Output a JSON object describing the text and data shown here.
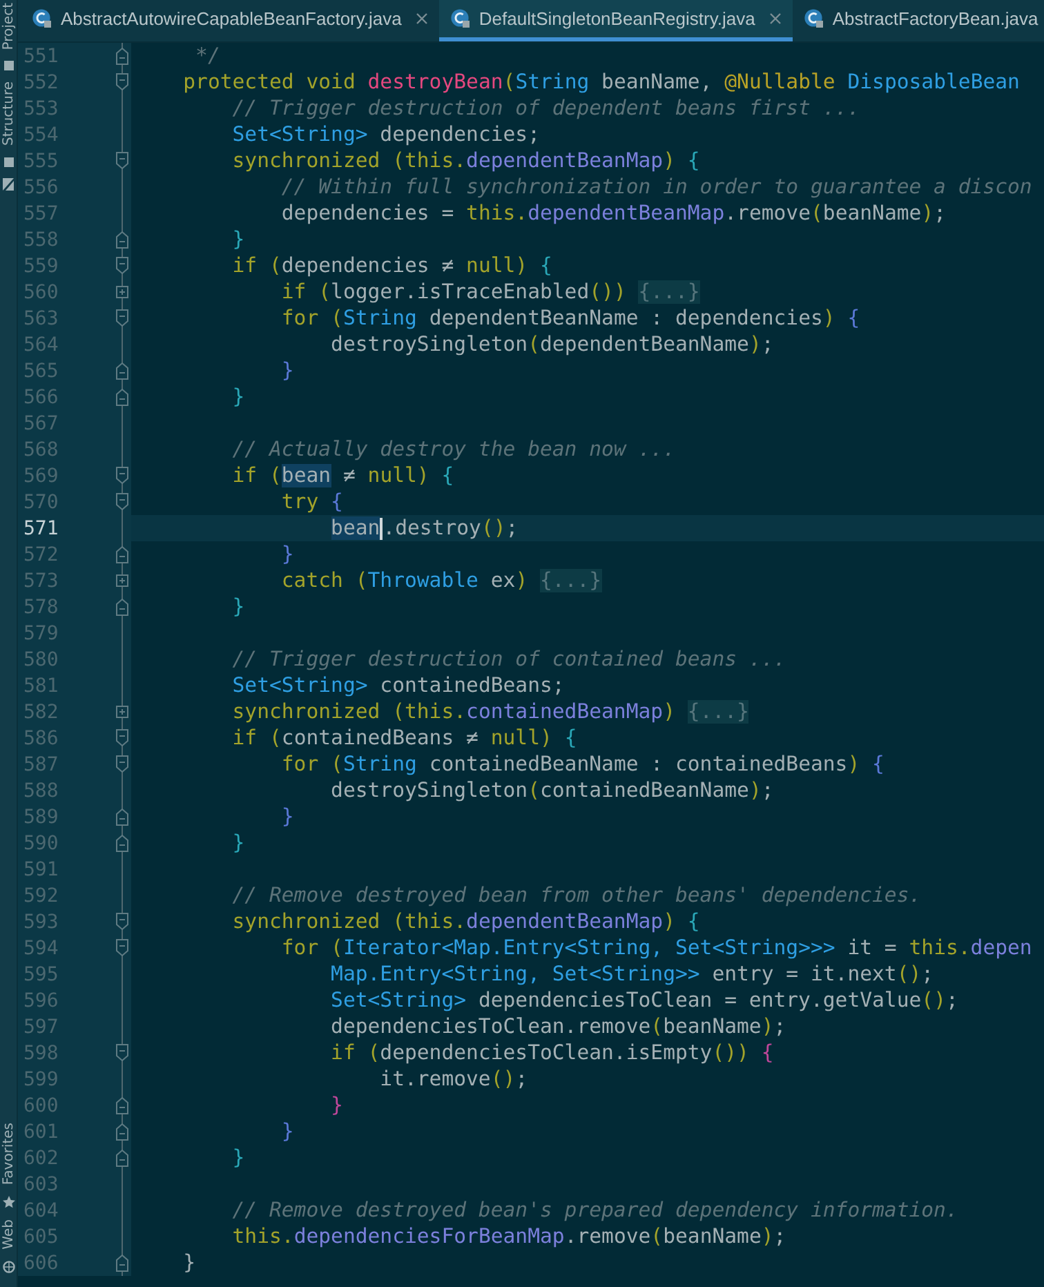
{
  "tool_strip": {
    "top": [
      "Project",
      "Structure"
    ],
    "bottom": [
      "Favorites",
      "Web"
    ]
  },
  "tabs": [
    {
      "label": "AbstractAutowireCapableBeanFactory.java",
      "selected": false
    },
    {
      "label": "DefaultSingletonBeanRegistry.java",
      "selected": true
    },
    {
      "label": "AbstractFactoryBean.java",
      "selected": false
    }
  ],
  "lines": [
    {
      "n": "551",
      "fold": {
        "kind": "end"
      },
      "current": false,
      "tokens": [
        {
          "kind": "comment",
          "text": "     */"
        }
      ]
    },
    {
      "n": "552",
      "fold": {
        "kind": "start"
      },
      "current": false,
      "tokens": [
        {
          "kind": "keyword",
          "text": "    protected void "
        },
        {
          "kind": "method",
          "text": "destroyBean"
        },
        {
          "kind": "keyword",
          "text": "("
        },
        {
          "kind": "type",
          "text": "String"
        },
        {
          "kind": "plain",
          "text": " beanName, "
        },
        {
          "kind": "annotation",
          "text": "@Nullable "
        },
        {
          "kind": "type",
          "text": "DisposableBean"
        }
      ]
    },
    {
      "n": "553",
      "current": false,
      "tokens": [
        {
          "kind": "comment",
          "text": "        // Trigger destruction of dependent beans first ..."
        }
      ]
    },
    {
      "n": "554",
      "current": false,
      "tokens": [
        {
          "kind": "type",
          "text": "        Set<String>"
        },
        {
          "kind": "plain",
          "text": " dependencies;"
        }
      ]
    },
    {
      "n": "555",
      "fold": {
        "kind": "start"
      },
      "current": false,
      "tokens": [
        {
          "kind": "keyword",
          "text": "        synchronized (this."
        },
        {
          "kind": "field",
          "text": "dependentBeanMap"
        },
        {
          "kind": "keyword",
          "text": ") "
        },
        {
          "kind": "brace",
          "text": "{"
        }
      ]
    },
    {
      "n": "556",
      "current": false,
      "tokens": [
        {
          "kind": "comment",
          "text": "            // Within full synchronization in order to guarantee a discon"
        }
      ]
    },
    {
      "n": "557",
      "current": false,
      "tokens": [
        {
          "kind": "plain",
          "text": "            dependencies = "
        },
        {
          "kind": "keyword",
          "text": "this."
        },
        {
          "kind": "field",
          "text": "dependentBeanMap"
        },
        {
          "kind": "plain",
          "text": ".remove"
        },
        {
          "kind": "keyword",
          "text": "("
        },
        {
          "kind": "plain",
          "text": "beanName"
        },
        {
          "kind": "keyword",
          "text": ")"
        },
        {
          "kind": "plain",
          "text": ";"
        }
      ]
    },
    {
      "n": "558",
      "fold": {
        "kind": "end"
      },
      "current": false,
      "tokens": [
        {
          "kind": "brace",
          "text": "        }"
        }
      ]
    },
    {
      "n": "559",
      "fold": {
        "kind": "start"
      },
      "current": false,
      "tokens": [
        {
          "kind": "keyword",
          "text": "        if ("
        },
        {
          "kind": "plain",
          "text": "dependencies ≠ "
        },
        {
          "kind": "keyword",
          "text": "null) "
        },
        {
          "kind": "brace",
          "text": "{"
        }
      ]
    },
    {
      "n": "560",
      "fold": {
        "kind": "collapsed"
      },
      "current": false,
      "tokens": [
        {
          "kind": "keyword",
          "text": "            if ("
        },
        {
          "kind": "plain",
          "text": "logger.isTraceEnabled"
        },
        {
          "kind": "keyword",
          "text": "()) "
        },
        {
          "kind": "folded",
          "text": "{...}"
        }
      ]
    },
    {
      "n": "563",
      "fold": {
        "kind": "start"
      },
      "current": false,
      "tokens": [
        {
          "kind": "keyword",
          "text": "            for ("
        },
        {
          "kind": "type",
          "text": "String"
        },
        {
          "kind": "plain",
          "text": " dependentBeanName : dependencies"
        },
        {
          "kind": "keyword",
          "text": ") "
        },
        {
          "kind": "brace2",
          "text": "{"
        }
      ]
    },
    {
      "n": "564",
      "current": false,
      "tokens": [
        {
          "kind": "plain",
          "text": "                destroySingleton"
        },
        {
          "kind": "keyword",
          "text": "("
        },
        {
          "kind": "plain",
          "text": "dependentBeanName"
        },
        {
          "kind": "keyword",
          "text": ")"
        },
        {
          "kind": "plain",
          "text": ";"
        }
      ]
    },
    {
      "n": "565",
      "fold": {
        "kind": "end"
      },
      "current": false,
      "tokens": [
        {
          "kind": "brace2",
          "text": "            }"
        }
      ]
    },
    {
      "n": "566",
      "fold": {
        "kind": "end"
      },
      "current": false,
      "tokens": [
        {
          "kind": "brace",
          "text": "        }"
        }
      ]
    },
    {
      "n": "567",
      "current": false
    },
    {
      "n": "568",
      "current": false,
      "tokens": [
        {
          "kind": "comment",
          "text": "        // Actually destroy the bean now ..."
        }
      ]
    },
    {
      "n": "569",
      "fold": {
        "kind": "start"
      },
      "current": false,
      "tokens": [
        {
          "kind": "keyword",
          "text": "        if ("
        },
        {
          "kind": "usage",
          "text": "bean"
        },
        {
          "kind": "plain",
          "text": " ≠ "
        },
        {
          "kind": "keyword",
          "text": "null) "
        },
        {
          "kind": "brace",
          "text": "{"
        }
      ]
    },
    {
      "n": "570",
      "fold": {
        "kind": "start"
      },
      "current": false,
      "tokens": [
        {
          "kind": "keyword",
          "text": "            try "
        },
        {
          "kind": "brace2",
          "text": "{"
        }
      ]
    },
    {
      "n": "571",
      "current": true,
      "tokens": [
        {
          "kind": "usage",
          "text": "                bean"
        },
        {
          "kind": "plain",
          "text": ".destroy"
        },
        {
          "kind": "keyword",
          "text": "()"
        },
        {
          "kind": "plain",
          "text": ";"
        }
      ]
    },
    {
      "n": "572",
      "fold": {
        "kind": "end"
      },
      "current": false,
      "tokens": [
        {
          "kind": "brace2",
          "text": "            }"
        }
      ]
    },
    {
      "n": "573",
      "fold": {
        "kind": "collapsed"
      },
      "current": false,
      "tokens": [
        {
          "kind": "keyword",
          "text": "            catch ("
        },
        {
          "kind": "type",
          "text": "Throwable"
        },
        {
          "kind": "plain",
          "text": " ex"
        },
        {
          "kind": "keyword",
          "text": ") "
        },
        {
          "kind": "folded",
          "text": "{...}"
        }
      ]
    },
    {
      "n": "578",
      "fold": {
        "kind": "end"
      },
      "current": false,
      "tokens": [
        {
          "kind": "brace",
          "text": "        }"
        }
      ]
    },
    {
      "n": "579",
      "current": false
    },
    {
      "n": "580",
      "current": false,
      "tokens": [
        {
          "kind": "comment",
          "text": "        // Trigger destruction of contained beans ..."
        }
      ]
    },
    {
      "n": "581",
      "current": false,
      "tokens": [
        {
          "kind": "type",
          "text": "        Set<String>"
        },
        {
          "kind": "plain",
          "text": " containedBeans;"
        }
      ]
    },
    {
      "n": "582",
      "fold": {
        "kind": "collapsed"
      },
      "current": false,
      "tokens": [
        {
          "kind": "keyword",
          "text": "        synchronized (this."
        },
        {
          "kind": "field",
          "text": "containedBeanMap"
        },
        {
          "kind": "keyword",
          "text": ") "
        },
        {
          "kind": "folded",
          "text": "{...}"
        }
      ]
    },
    {
      "n": "586",
      "fold": {
        "kind": "start"
      },
      "current": false,
      "tokens": [
        {
          "kind": "keyword",
          "text": "        if ("
        },
        {
          "kind": "plain",
          "text": "containedBeans ≠ "
        },
        {
          "kind": "keyword",
          "text": "null) "
        },
        {
          "kind": "brace",
          "text": "{"
        }
      ]
    },
    {
      "n": "587",
      "fold": {
        "kind": "start"
      },
      "current": false,
      "tokens": [
        {
          "kind": "keyword",
          "text": "            for ("
        },
        {
          "kind": "type",
          "text": "String"
        },
        {
          "kind": "plain",
          "text": " containedBeanName : containedBeans"
        },
        {
          "kind": "keyword",
          "text": ") "
        },
        {
          "kind": "brace2",
          "text": "{"
        }
      ]
    },
    {
      "n": "588",
      "current": false,
      "tokens": [
        {
          "kind": "plain",
          "text": "                destroySingleton"
        },
        {
          "kind": "keyword",
          "text": "("
        },
        {
          "kind": "plain",
          "text": "containedBeanName"
        },
        {
          "kind": "keyword",
          "text": ")"
        },
        {
          "kind": "plain",
          "text": ";"
        }
      ]
    },
    {
      "n": "589",
      "fold": {
        "kind": "end"
      },
      "current": false,
      "tokens": [
        {
          "kind": "brace2",
          "text": "            }"
        }
      ]
    },
    {
      "n": "590",
      "fold": {
        "kind": "end"
      },
      "current": false,
      "tokens": [
        {
          "kind": "brace",
          "text": "        }"
        }
      ]
    },
    {
      "n": "591",
      "current": false
    },
    {
      "n": "592",
      "current": false,
      "tokens": [
        {
          "kind": "comment",
          "text": "        // Remove destroyed bean from other beans' dependencies."
        }
      ]
    },
    {
      "n": "593",
      "fold": {
        "kind": "start"
      },
      "current": false,
      "tokens": [
        {
          "kind": "keyword",
          "text": "        synchronized (this."
        },
        {
          "kind": "field",
          "text": "dependentBeanMap"
        },
        {
          "kind": "keyword",
          "text": ") "
        },
        {
          "kind": "brace",
          "text": "{"
        }
      ]
    },
    {
      "n": "594",
      "fold": {
        "kind": "start"
      },
      "current": false,
      "tokens": [
        {
          "kind": "keyword",
          "text": "            for ("
        },
        {
          "kind": "type",
          "text": "Iterator<Map.Entry<String, Set<String>>>"
        },
        {
          "kind": "plain",
          "text": " it = "
        },
        {
          "kind": "keyword",
          "text": "this."
        },
        {
          "kind": "field",
          "text": "depen"
        }
      ]
    },
    {
      "n": "595",
      "current": false,
      "tokens": [
        {
          "kind": "type",
          "text": "                Map.Entry<String, Set<String>>"
        },
        {
          "kind": "plain",
          "text": " entry = it.next"
        },
        {
          "kind": "keyword",
          "text": "()"
        },
        {
          "kind": "plain",
          "text": ";"
        }
      ]
    },
    {
      "n": "596",
      "current": false,
      "tokens": [
        {
          "kind": "type",
          "text": "                Set<String>"
        },
        {
          "kind": "plain",
          "text": " dependenciesToClean = entry.getValue"
        },
        {
          "kind": "keyword",
          "text": "()"
        },
        {
          "kind": "plain",
          "text": ";"
        }
      ]
    },
    {
      "n": "597",
      "current": false,
      "tokens": [
        {
          "kind": "plain",
          "text": "                dependenciesToClean.remove"
        },
        {
          "kind": "keyword",
          "text": "("
        },
        {
          "kind": "plain",
          "text": "beanName"
        },
        {
          "kind": "keyword",
          "text": ")"
        },
        {
          "kind": "plain",
          "text": ";"
        }
      ]
    },
    {
      "n": "598",
      "fold": {
        "kind": "start"
      },
      "current": false,
      "tokens": [
        {
          "kind": "keyword",
          "text": "                if ("
        },
        {
          "kind": "plain",
          "text": "dependenciesToClean.isEmpty"
        },
        {
          "kind": "keyword",
          "text": "()) "
        },
        {
          "kind": "brace3",
          "text": "{"
        }
      ]
    },
    {
      "n": "599",
      "current": false,
      "tokens": [
        {
          "kind": "plain",
          "text": "                    it.remove"
        },
        {
          "kind": "keyword",
          "text": "()"
        },
        {
          "kind": "plain",
          "text": ";"
        }
      ]
    },
    {
      "n": "600",
      "fold": {
        "kind": "end"
      },
      "current": false,
      "tokens": [
        {
          "kind": "brace3",
          "text": "                }"
        }
      ]
    },
    {
      "n": "601",
      "fold": {
        "kind": "end"
      },
      "current": false,
      "tokens": [
        {
          "kind": "brace2",
          "text": "            }"
        }
      ]
    },
    {
      "n": "602",
      "fold": {
        "kind": "end"
      },
      "current": false,
      "tokens": [
        {
          "kind": "brace",
          "text": "        }"
        }
      ]
    },
    {
      "n": "603",
      "current": false
    },
    {
      "n": "604",
      "current": false,
      "tokens": [
        {
          "kind": "comment",
          "text": "        // Remove destroyed bean's prepared dependency information."
        }
      ]
    },
    {
      "n": "605",
      "current": false,
      "tokens": [
        {
          "kind": "keyword",
          "text": "        this."
        },
        {
          "kind": "field",
          "text": "dependenciesForBeanMap"
        },
        {
          "kind": "plain",
          "text": ".remove"
        },
        {
          "kind": "keyword",
          "text": "("
        },
        {
          "kind": "plain",
          "text": "beanName"
        },
        {
          "kind": "keyword",
          "text": ")"
        },
        {
          "kind": "plain",
          "text": ";"
        }
      ]
    },
    {
      "n": "606",
      "fold": {
        "kind": "end"
      },
      "current": false,
      "tokens": [
        {
          "kind": "plain",
          "text": "    }"
        }
      ]
    }
  ]
}
